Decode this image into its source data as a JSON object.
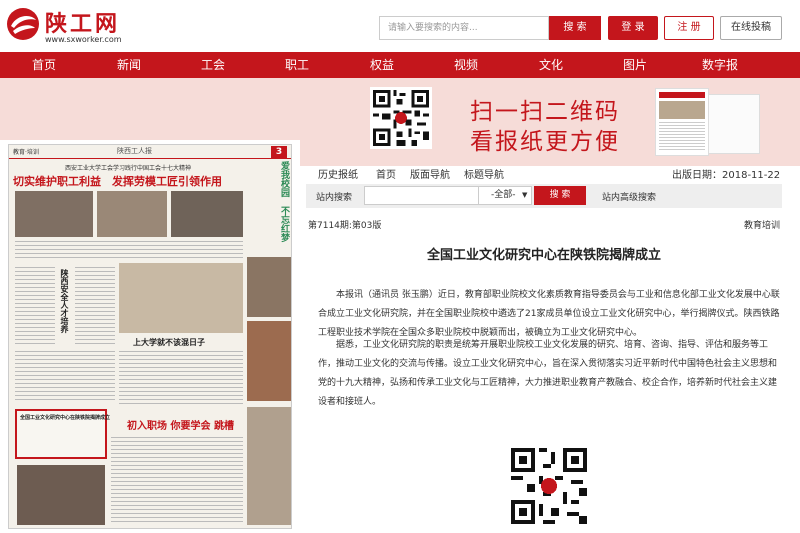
{
  "site": {
    "title": "陕工网",
    "url": "www.sxworker.com"
  },
  "header": {
    "search_placeholder": "请输入要搜索的内容...",
    "search_button": "搜 索",
    "login_button": "登 录",
    "register_button": "注 册",
    "submit_button": "在线投稿"
  },
  "nav": {
    "items": [
      "首页",
      "新闻",
      "工会",
      "职工",
      "权益",
      "视频",
      "文化",
      "图片",
      "数字报"
    ]
  },
  "banner": {
    "line1": "扫一扫二维码",
    "line2": "看报纸更方便"
  },
  "paper": {
    "section": "教育·培训",
    "name": "陕西工人报",
    "page_number": "3",
    "kicker": "西安工业大学工会学习践行中国工会十七大精神",
    "headline": "切实维护职工利益　发挥劳模工匠引领作用",
    "side_title": "爱我校园　不忘红梦",
    "sub1": "陕西安全人才培养",
    "title2": "上大学就不该混日子",
    "title3": "初入职场 你要学会 跳槽",
    "highlight_title": "全国工业文化研究中心在陕铁院揭牌成立"
  },
  "tools": {
    "links": [
      "历史报纸",
      "首页",
      "版面导航",
      "标题导航"
    ],
    "pub_date": "出版日期：2018-11-22",
    "site_search_label": "站内搜索",
    "scope_selected": "-全部-",
    "search_button": "搜 索",
    "advanced_search": "站内高级搜索"
  },
  "article": {
    "issue": "第7114期:第03版",
    "page_section": "教育培训",
    "title": "全国工业文化研究中心在陕铁院揭牌成立",
    "paragraphs": [
      "本报讯（通讯员 张玉鹏）近日，教育部职业院校文化素质教育指导委员会与工业和信息化部工业文化发展中心联合成立工业文化研究院，并在全国职业院校中遴选了21家成员单位设立工业文化研究中心，举行揭牌仪式。陕西铁路工程职业技术学院在全国众多职业院校中脱颖而出，被确立为工业文化研究中心。",
      "据悉，工业文化研究院的职责是统筹开展职业院校工业文化发展的研究、培育、咨询、指导、评估和服务等工作，推动工业文化的交流与传播。设立工业文化研究中心，旨在深入贯彻落实习近平新时代中国特色社会主义思想和党的十九大精神，弘扬和传承工业文化与工匠精神，大力推进职业教育产教融合、校企合作，培养新时代社会主义建设者和接班人。"
    ]
  },
  "colors": {
    "brand_red": "#c4161c",
    "banner_pink": "#f6dcd8",
    "search_bar_gray": "#eeeeee"
  },
  "icons": [
    "logo-mark-icon",
    "qr-code-icon",
    "chevron-down-icon"
  ]
}
